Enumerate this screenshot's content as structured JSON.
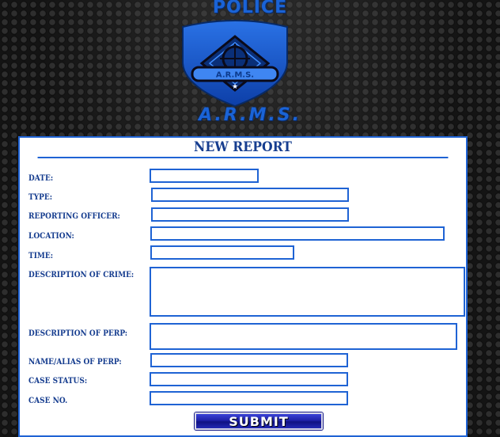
{
  "logo": {
    "top_text": "POLICE",
    "badge_text": "A.R.M.S.",
    "bottom_text": "A.R.M.S."
  },
  "form": {
    "title": "NEW REPORT",
    "fields": {
      "date": {
        "label": "DATE:",
        "value": ""
      },
      "type": {
        "label": "TYPE:",
        "value": ""
      },
      "reporting_officer": {
        "label": "REPORTING OFFICER:",
        "value": ""
      },
      "location": {
        "label": "LOCATION:",
        "value": ""
      },
      "time": {
        "label": "TIME:",
        "value": ""
      },
      "description_of_crime": {
        "label": "DESCRIPTION OF CRIME:",
        "value": ""
      },
      "description_of_perp": {
        "label": "DESCRIPTION OF PERP:",
        "value": ""
      },
      "name_alias_of_perp": {
        "label": "NAME/ALIAS OF PERP:",
        "value": ""
      },
      "case_status": {
        "label": "CASE STATUS:",
        "value": ""
      },
      "case_no": {
        "label": "CASE NO.",
        "value": ""
      }
    },
    "submit_label": "SUBMIT"
  },
  "colors": {
    "accent": "#1f63d4",
    "label_text": "#163d8f",
    "button": "#1f22a8",
    "background": "#141414"
  }
}
